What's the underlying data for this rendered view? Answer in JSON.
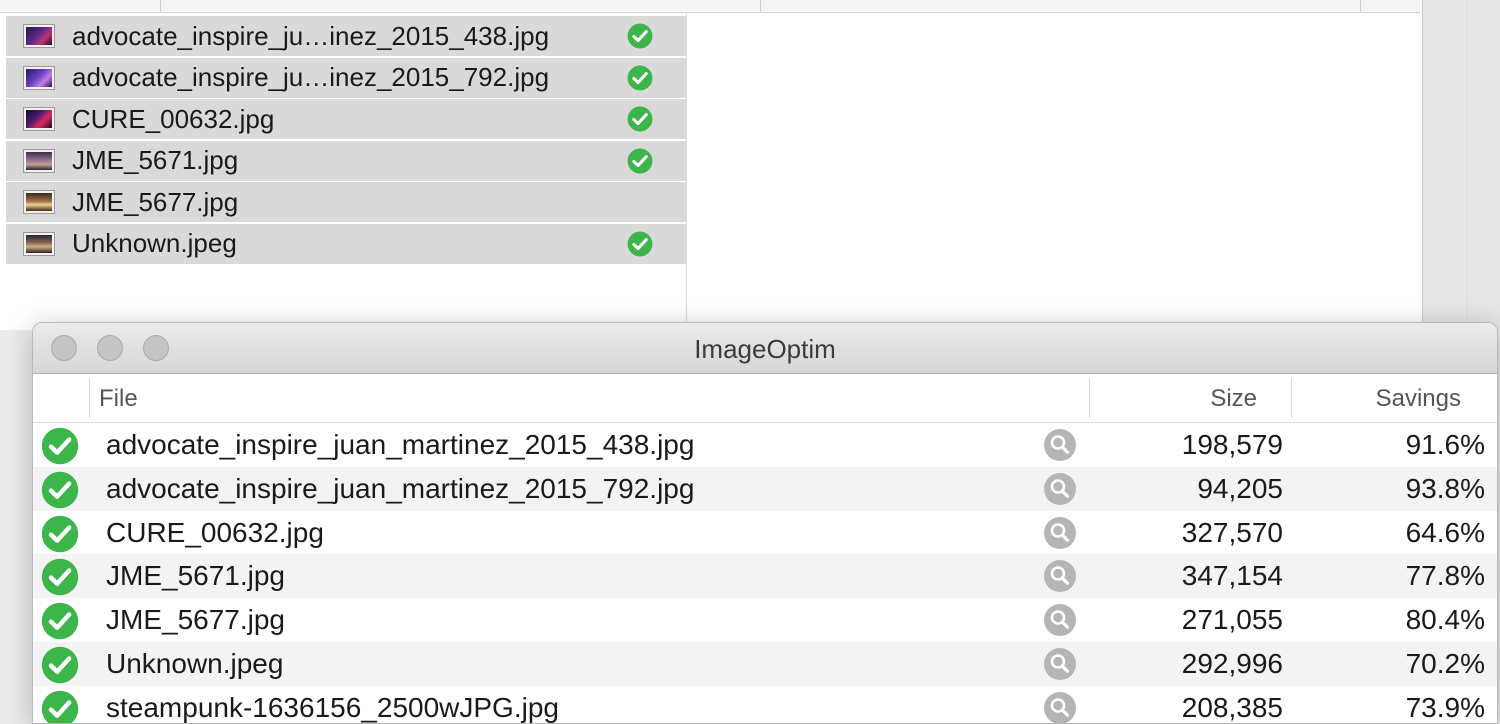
{
  "finder": {
    "files": [
      {
        "name": "advocate_inspire_ju…inez_2015_438.jpg",
        "thumb": "thumb-purple",
        "done": true
      },
      {
        "name": "advocate_inspire_ju…inez_2015_792.jpg",
        "thumb": "thumb-violet",
        "done": true
      },
      {
        "name": "CURE_00632.jpg",
        "thumb": "thumb-magenta",
        "done": true
      },
      {
        "name": "JME_5671.jpg",
        "thumb": "thumb-stage",
        "done": true
      },
      {
        "name": "JME_5677.jpg",
        "thumb": "thumb-warm",
        "done": false
      },
      {
        "name": "Unknown.jpeg",
        "thumb": "thumb-hall",
        "done": true
      }
    ]
  },
  "imageoptim": {
    "title": "ImageOptim",
    "columns": {
      "file": "File",
      "size": "Size",
      "savings": "Savings"
    },
    "rows": [
      {
        "file": "advocate_inspire_juan_martinez_2015_438.jpg",
        "size": "198,579",
        "savings": "91.6%"
      },
      {
        "file": "advocate_inspire_juan_martinez_2015_792.jpg",
        "size": "94,205",
        "savings": "93.8%"
      },
      {
        "file": "CURE_00632.jpg",
        "size": "327,570",
        "savings": "64.6%"
      },
      {
        "file": "JME_5671.jpg",
        "size": "347,154",
        "savings": "77.8%"
      },
      {
        "file": "JME_5677.jpg",
        "size": "271,055",
        "savings": "80.4%"
      },
      {
        "file": "Unknown.jpeg",
        "size": "292,996",
        "savings": "70.2%"
      },
      {
        "file": "steampunk-1636156_2500wJPG.jpg",
        "size": "208,385",
        "savings": "73.9%"
      }
    ]
  },
  "colors": {
    "check_green": "#3cb54a",
    "selection_gray": "#d9d9d9",
    "magnify_gray": "#b5b5b5"
  },
  "icons": {
    "status": "checkmark-circle-icon",
    "preview": "magnifier-icon"
  }
}
